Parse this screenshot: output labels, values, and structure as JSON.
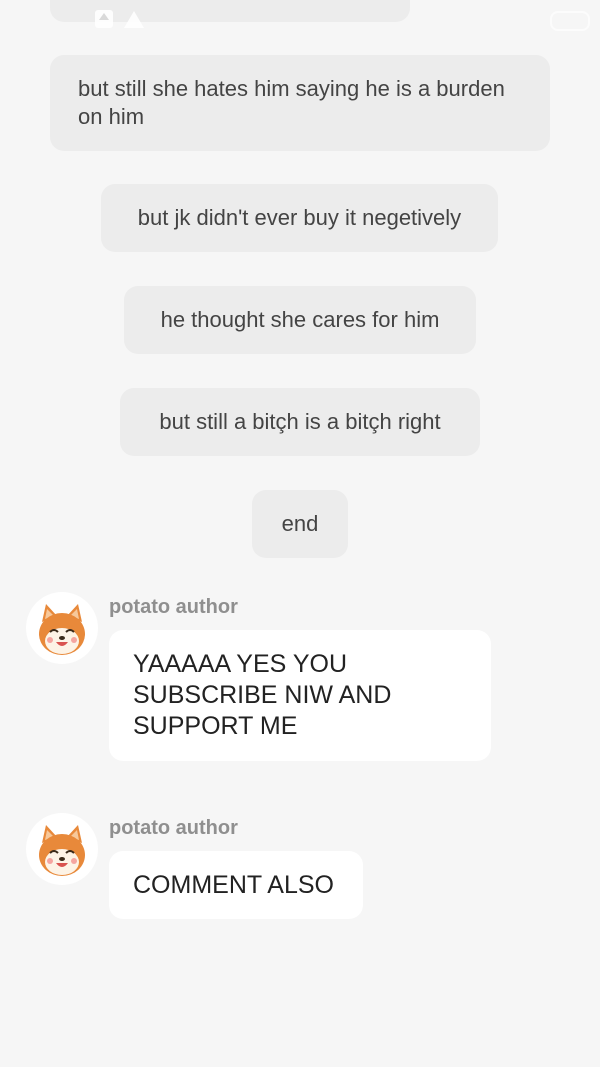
{
  "status_bar": {
    "left_text": "•••",
    "right_text": "•••"
  },
  "messages": [
    {
      "text": "but still she hates him saying he is a burden on him"
    },
    {
      "text": "but jk didn't ever buy it negetively"
    },
    {
      "text": "he thought she cares for him"
    },
    {
      "text": "but still a bitçh is a bitçh right"
    },
    {
      "text": "end"
    }
  ],
  "author_messages": [
    {
      "author": "potato author",
      "text": "YAAAAA YES YOU SUBSCRIBE NIW AND SUPPORT ME"
    },
    {
      "author": "potato author",
      "text": "COMMENT ALSO"
    }
  ],
  "colors": {
    "background": "#f6f6f6",
    "bubble": "#ececec",
    "author_bubble": "#ffffff",
    "author_name": "#8f8f8f"
  }
}
